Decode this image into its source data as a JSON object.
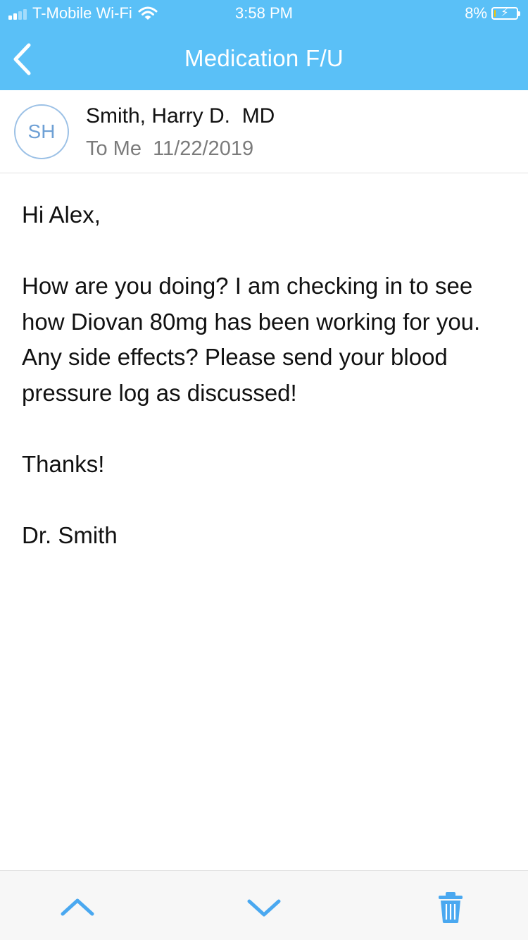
{
  "status_bar": {
    "carrier": "T-Mobile Wi-Fi",
    "time": "3:58 PM",
    "battery_percent": "8%",
    "battery_level": 0.08,
    "icons": [
      "signal-icon",
      "wifi-icon",
      "battery-icon",
      "charging-icon"
    ]
  },
  "nav": {
    "back_icon": "chevron-left-icon",
    "title": "Medication F/U"
  },
  "message": {
    "avatar_initials": "SH",
    "sender": "Smith, Harry D.  MD",
    "meta": "To Me  11/22/2019",
    "greeting": "Hi Alex,",
    "body_line_1": "How are you doing? I am checking in to see how Diovan 80mg has been working for you.",
    "body_line_2": "Any side effects? Please send your blood pressure log as discussed!",
    "thanks": "Thanks!",
    "signature": "Dr. Smith"
  },
  "toolbar": {
    "buttons": [
      "previous-message",
      "next-message",
      "delete-message"
    ],
    "icons": [
      "chevron-up-icon",
      "chevron-down-icon",
      "trash-icon"
    ]
  },
  "colors": {
    "header": "#5ac0f7",
    "accent": "#4aa8f0",
    "avatar": "#6ea0d5"
  }
}
